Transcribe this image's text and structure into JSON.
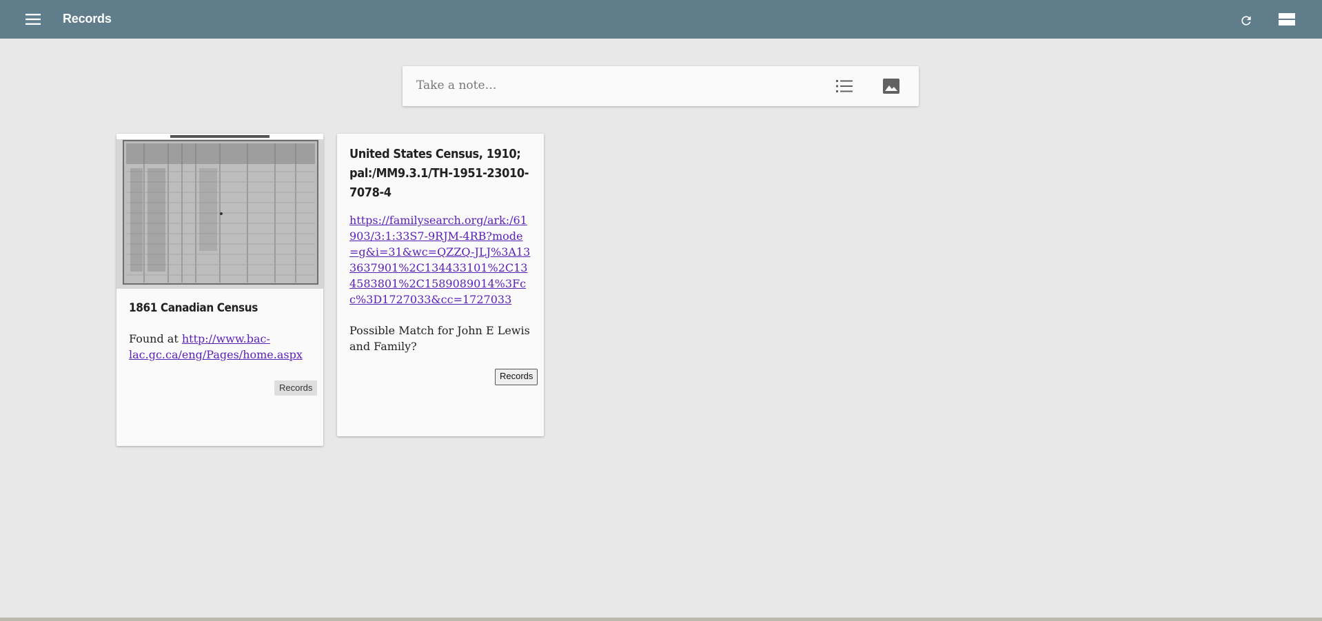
{
  "header": {
    "title": "Records",
    "menu_icon": "hamburger-icon",
    "refresh_icon": "refresh-icon",
    "layout_icon": "view-list-icon",
    "bar_color": "#607d8b"
  },
  "note_bar": {
    "placeholder": "Take a note…",
    "list_icon": "checklist-icon",
    "image_icon": "image-icon"
  },
  "cards": [
    {
      "image_alt": "1861 Canadian Census scanned page",
      "title": "1861 Canadian Census",
      "text_prefix": "Found at ",
      "link": "http://www.bac-lac.gc.ca/eng/Pages/home.aspx",
      "label": "Records"
    },
    {
      "title": "United States Census, 1910; pal:/MM9.3.1/TH-1951-23010-7078-4",
      "link": "https://familysearch.org/ark:/61903/3:1:33S7-9RJM-4RB?mode=g&i=31&wc=QZZQ-JLJ%3A133637901%2C134433101%2C134583801%2C1589089014%3Fcc%3D1727033&cc=1727033",
      "note": "Possible Match for John E Lewis and Family?",
      "label": "Records"
    }
  ],
  "colors": {
    "background": "#e8e8e8",
    "link": "#5a1fb5"
  }
}
